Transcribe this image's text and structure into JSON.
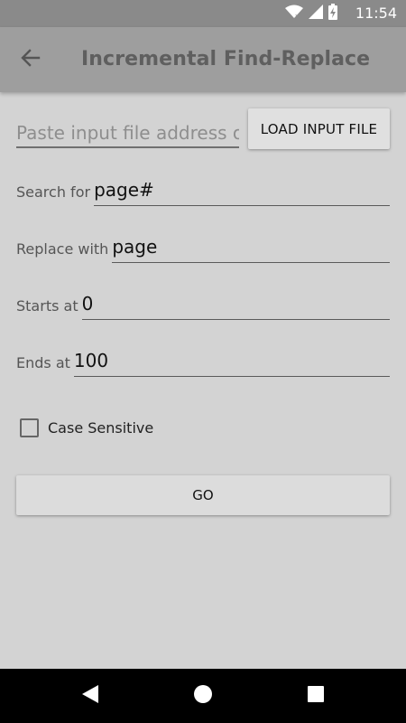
{
  "status_bar": {
    "time": "11:54",
    "icons": [
      "wifi-icon",
      "signal-icon",
      "battery-charging-icon"
    ]
  },
  "app_bar": {
    "title": "Incremental Find-Replace",
    "back_icon": "back-arrow-icon"
  },
  "input_file": {
    "placeholder": "Paste input file address or use button",
    "value": "",
    "load_button_label": "LOAD INPUT FILE"
  },
  "search": {
    "label": "Search for",
    "value": "page#"
  },
  "replace": {
    "label": "Replace with",
    "value": "page"
  },
  "starts_at": {
    "label": "Starts at",
    "value": "0"
  },
  "ends_at": {
    "label": "Ends at",
    "value": "100"
  },
  "case_sensitive": {
    "label": "Case Sensitive",
    "checked": false
  },
  "go_button": {
    "label": "GO"
  },
  "nav_bar": {
    "icons": [
      "nav-back-icon",
      "nav-home-icon",
      "nav-recents-icon"
    ]
  },
  "colors": {
    "background": "#d3d3d3",
    "status_bar": "#8a8a8a",
    "app_bar": "#9e9e9e",
    "button": "#e0e0e0",
    "nav_bar": "#000000"
  }
}
